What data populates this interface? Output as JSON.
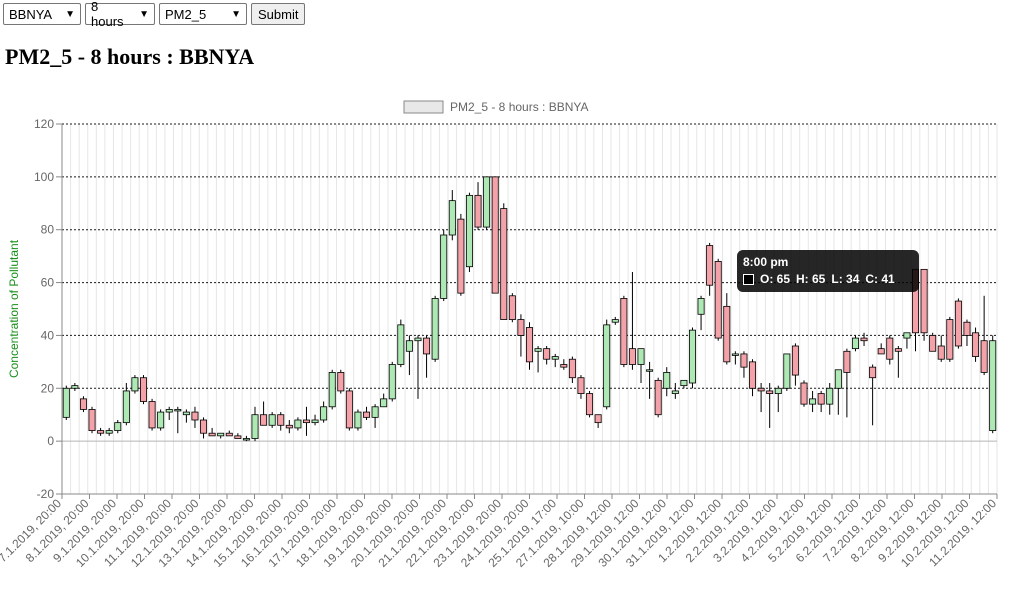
{
  "controls": {
    "station": "BBNYA",
    "interval": "8 hours",
    "pollutant": "PM2_5",
    "submit": "Submit"
  },
  "page_title": "PM2_5 - 8 hours : BBNYA",
  "tooltip": {
    "title": "8:00 pm",
    "o": "O: 65",
    "h": "H: 65",
    "l": "L: 34",
    "c": "C: 41"
  },
  "colors": {
    "up": "#aee8b4",
    "down": "#f2a2a8",
    "grid": "#000000",
    "tooltip_bg": "#000000"
  },
  "chart_data": {
    "type": "candlestick",
    "legend": "PM2_5 - 8 hours  :  BBNYA",
    "ylabel": "Concentration of Pollutant",
    "ylim": [
      -20,
      120
    ],
    "yticks": [
      -20,
      0,
      20,
      40,
      60,
      80,
      100,
      120
    ],
    "xtick_labels": [
      "7.1.2019, 20:00",
      "8.1.2019, 20:00",
      "9.1.2019, 20:00",
      "10.1.2019, 20:00",
      "11.1.2019, 20:00",
      "12.1.2019, 20:00",
      "13.1.2019, 20:00",
      "14.1.2019, 20:00",
      "15.1.2019, 20:00",
      "16.1.2019, 20:00",
      "17.1.2019, 20:00",
      "18.1.2019, 20:00",
      "19.1.2019, 20:00",
      "20.1.2019, 20:00",
      "21.1.2019, 20:00",
      "22.1.2019, 20:00",
      "23.1.2019, 20:00",
      "24.1.2019, 20:00",
      "25.1.2019, 17:00",
      "27.1.2019, 10:00",
      "28.1.2019, 12:00",
      "29.1.2019, 12:00",
      "30.1.2019, 12:00",
      "31.1.2019, 12:00",
      "1.2.2019, 12:00",
      "2.2.2019, 12:00",
      "3.2.2019, 12:00",
      "4.2.2019, 12:00",
      "5.2.2019, 12:00",
      "6.2.2019, 12:00",
      "7.2.2019, 12:00",
      "8.2.2019, 12:00",
      "9.2.2019, 12:00",
      "10.2.2019, 12:00",
      "11.2.2019, 12:00"
    ],
    "candles": [
      [
        9,
        21,
        8,
        20
      ],
      [
        20,
        22,
        19,
        21
      ],
      [
        16,
        17,
        11,
        12
      ],
      [
        12,
        13,
        3,
        4
      ],
      [
        4,
        5,
        2,
        3
      ],
      [
        3,
        5,
        2,
        4
      ],
      [
        4,
        8,
        3,
        7
      ],
      [
        7,
        22,
        6,
        19
      ],
      [
        19,
        25,
        18,
        24
      ],
      [
        24,
        25,
        14,
        15
      ],
      [
        15,
        16,
        4,
        5
      ],
      [
        5,
        12,
        4,
        11
      ],
      [
        11,
        13,
        8,
        12
      ],
      [
        12,
        13,
        3,
        12
      ],
      [
        10,
        12,
        7,
        11
      ],
      [
        11,
        13,
        5,
        8
      ],
      [
        8,
        9,
        1,
        3
      ],
      [
        3,
        5,
        2,
        2
      ],
      [
        2,
        3,
        1,
        3
      ],
      [
        3,
        4,
        2,
        2
      ],
      [
        2,
        3,
        1,
        1
      ],
      [
        1,
        2,
        0,
        1
      ],
      [
        1,
        13,
        0,
        10
      ],
      [
        10,
        15,
        6,
        6
      ],
      [
        6,
        11,
        5,
        10
      ],
      [
        10,
        11,
        4,
        6
      ],
      [
        6,
        8,
        3,
        5
      ],
      [
        5,
        9,
        4,
        8
      ],
      [
        8,
        13,
        2,
        7
      ],
      [
        7,
        10,
        6,
        8
      ],
      [
        8,
        15,
        7,
        13
      ],
      [
        13,
        27,
        12,
        26
      ],
      [
        26,
        27,
        18,
        19
      ],
      [
        19,
        20,
        4,
        5
      ],
      [
        5,
        12,
        4,
        11
      ],
      [
        11,
        13,
        8,
        9
      ],
      [
        9,
        14,
        5,
        13
      ],
      [
        13,
        18,
        14,
        16
      ],
      [
        16,
        30,
        15,
        29
      ],
      [
        29,
        46,
        28,
        44
      ],
      [
        34,
        40,
        25,
        38
      ],
      [
        38,
        40,
        16,
        39
      ],
      [
        39,
        40,
        24,
        33
      ],
      [
        31,
        55,
        30,
        54
      ],
      [
        54,
        80,
        53,
        78
      ],
      [
        78,
        95,
        76,
        91
      ],
      [
        84,
        86,
        55,
        56
      ],
      [
        66,
        94,
        64,
        93
      ],
      [
        93,
        98,
        80,
        81
      ],
      [
        81,
        100,
        80,
        100
      ],
      [
        100,
        100,
        79,
        56
      ],
      [
        88,
        90,
        55,
        46
      ],
      [
        55,
        56,
        45,
        46
      ],
      [
        46,
        48,
        32,
        40
      ],
      [
        43,
        45,
        27,
        30
      ],
      [
        34,
        36,
        26,
        35
      ],
      [
        35,
        36,
        29,
        31
      ],
      [
        31,
        33,
        28,
        32
      ],
      [
        29,
        31,
        27,
        28
      ],
      [
        31,
        32,
        22,
        24
      ],
      [
        24,
        25,
        16,
        18
      ],
      [
        18,
        19,
        9,
        10
      ],
      [
        10,
        10,
        5,
        7
      ],
      [
        13,
        46,
        12,
        44
      ],
      [
        45,
        47,
        44,
        46
      ],
      [
        54,
        55,
        28,
        29
      ],
      [
        35,
        64,
        27,
        29
      ],
      [
        29,
        35,
        22,
        35
      ],
      [
        27,
        30,
        16,
        27
      ],
      [
        23,
        24,
        9,
        10
      ],
      [
        20,
        28,
        17,
        26
      ],
      [
        18,
        22,
        16,
        19
      ],
      [
        21,
        22,
        20,
        23
      ],
      [
        22,
        43,
        20,
        42
      ],
      [
        48,
        55,
        42,
        54
      ],
      [
        74,
        75,
        55,
        59
      ],
      [
        68,
        69,
        38,
        39
      ],
      [
        51,
        56,
        29,
        30
      ],
      [
        33,
        34,
        29,
        33
      ],
      [
        33,
        34,
        24,
        28
      ],
      [
        30,
        31,
        17,
        20
      ],
      [
        20,
        22,
        11,
        19
      ],
      [
        19,
        22,
        5,
        18
      ],
      [
        18,
        21,
        11,
        20
      ],
      [
        20,
        33,
        19,
        33
      ],
      [
        36,
        37,
        21,
        25
      ],
      [
        22,
        23,
        13,
        14
      ],
      [
        14,
        19,
        11,
        16
      ],
      [
        18,
        19,
        11,
        14
      ],
      [
        14,
        22,
        10,
        20
      ],
      [
        20,
        27,
        10,
        27
      ],
      [
        34,
        35,
        9,
        26
      ],
      [
        35,
        40,
        34,
        39
      ],
      [
        39,
        41,
        36,
        38
      ],
      [
        28,
        29,
        6,
        24
      ],
      [
        35,
        37,
        33,
        33
      ],
      [
        39,
        40,
        29,
        31
      ],
      [
        35,
        36,
        24,
        34
      ],
      [
        39,
        41,
        35,
        41
      ],
      [
        65,
        65,
        34,
        41
      ],
      [
        65,
        65,
        38,
        41
      ],
      [
        40,
        41,
        35,
        34
      ],
      [
        36,
        40,
        30,
        31
      ],
      [
        46,
        47,
        30,
        31
      ],
      [
        53,
        54,
        35,
        36
      ],
      [
        45,
        46,
        36,
        40
      ],
      [
        41,
        43,
        30,
        32
      ],
      [
        38,
        55,
        25,
        26
      ],
      [
        4,
        40,
        3,
        38
      ]
    ]
  }
}
